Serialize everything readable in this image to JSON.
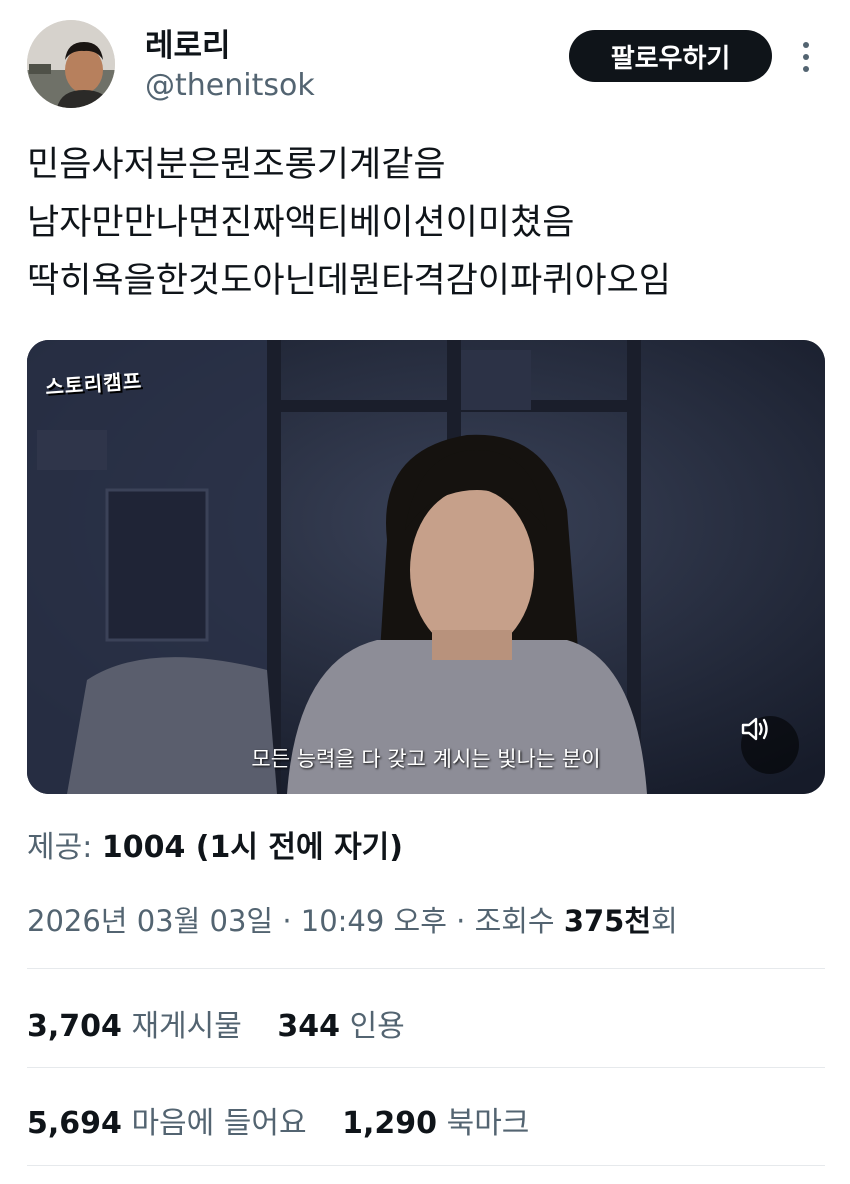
{
  "user": {
    "name": "레로리",
    "handle": "@thenitsok",
    "follow_label": "팔로우하기"
  },
  "tweet": {
    "lines": [
      "민음사저분은뭔조롱기계같음",
      "남자만만나면진짜액티베이션이미쳤음",
      "딱히욕을한것도아닌데뭔타격감이파퀴아오임"
    ]
  },
  "media": {
    "watermark": "스토리캠프",
    "subtitle": "모든 능력을 다 갖고 계시는 빛나는 분이",
    "sound_icon": "speaker-icon"
  },
  "provided": {
    "label": "제공:",
    "value": "1004 (1시 전에 자기)"
  },
  "meta": {
    "date": "2026년 03월 03일",
    "time": "10:49 오후",
    "views_label": "조회수",
    "views_value": "375천",
    "views_suffix": "회"
  },
  "stats": {
    "reposts_count": "3,704",
    "reposts_label": "재게시물",
    "quotes_count": "344",
    "quotes_label": "인용",
    "likes_count": "5,694",
    "likes_label": "마음에 들어요",
    "bookmarks_count": "1,290",
    "bookmarks_label": "북마크"
  }
}
